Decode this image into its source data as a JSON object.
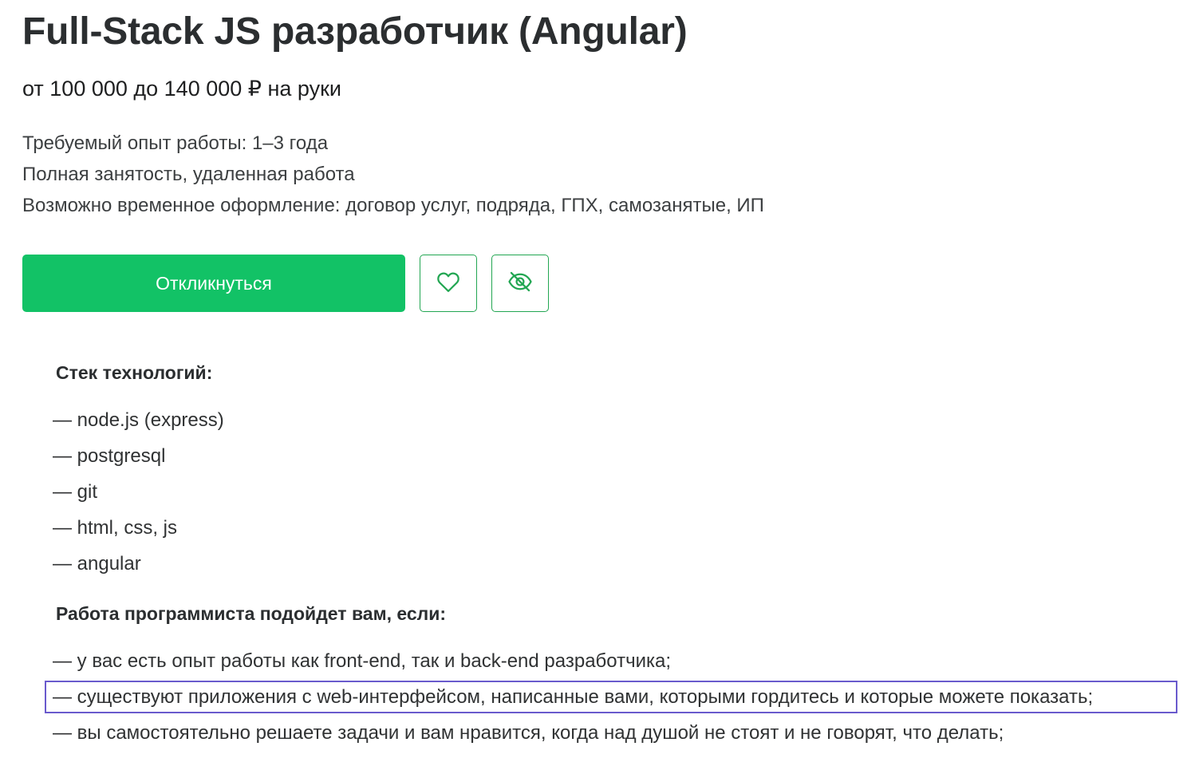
{
  "vacancy": {
    "title": "Full-Stack JS разработчик (Angular)",
    "salary": "от 100 000 до 140 000 ₽ на руки",
    "experience": "Требуемый опыт работы: 1–3 года",
    "employment": "Полная занятость, удаленная работа",
    "contract": "Возможно временное оформление: договор услуг, подряда, ГПХ, самозанятые, ИП"
  },
  "actions": {
    "respond_label": "Откликнуться",
    "favorite_icon": "heart-icon",
    "hide_icon": "eye-off-icon",
    "accent_color": "#12c266"
  },
  "stack": {
    "heading": "Стек технологий:",
    "items": [
      "— node.js (express)",
      "— postgresql",
      "— git",
      "— html, css, js",
      "— angular"
    ]
  },
  "fit": {
    "heading": "Работа программиста подойдет вам, если:",
    "items": [
      "— у вас есть опыт работы как front-end, так и back-end разработчика;",
      "— существуют приложения с web-интерфейсом, написанные вами, которыми гордитесь и которые можете показать;",
      "— вы самостоятельно решаете задачи и вам нравится, когда над душой не стоят и не говорят, что делать;"
    ]
  }
}
